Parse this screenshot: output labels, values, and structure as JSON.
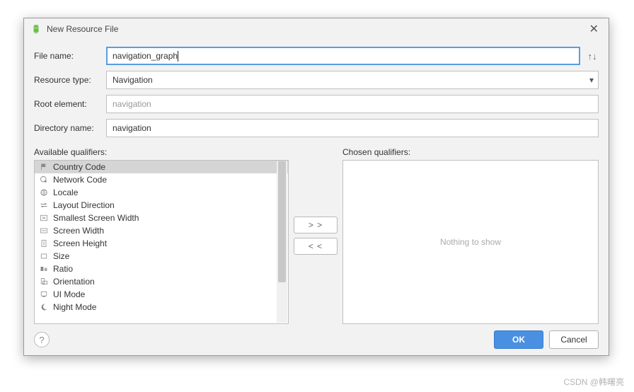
{
  "titlebar": {
    "title": "New Resource File",
    "close_glyph": "✕"
  },
  "form": {
    "file_name": {
      "label": "File name:",
      "value": "navigation_graph",
      "swap_glyph": "↑↓"
    },
    "resource_type": {
      "label": "Resource type:",
      "value": "Navigation"
    },
    "root_element": {
      "label": "Root element:",
      "value": "navigation"
    },
    "directory_name": {
      "label": "Directory name:",
      "value": "navigation"
    }
  },
  "qualifiers": {
    "available_title": "Available qualifiers:",
    "chosen_title": "Chosen qualifiers:",
    "available": [
      {
        "label": "Country Code",
        "icon": "flag",
        "selected": true
      },
      {
        "label": "Network Code",
        "icon": "globe-pin"
      },
      {
        "label": "Locale",
        "icon": "globe"
      },
      {
        "label": "Layout Direction",
        "icon": "arrows"
      },
      {
        "label": "Smallest Screen Width",
        "icon": "sw"
      },
      {
        "label": "Screen Width",
        "icon": "w"
      },
      {
        "label": "Screen Height",
        "icon": "h"
      },
      {
        "label": "Size",
        "icon": "rect"
      },
      {
        "label": "Ratio",
        "icon": "ratio"
      },
      {
        "label": "Orientation",
        "icon": "orient"
      },
      {
        "label": "UI Mode",
        "icon": "ui"
      },
      {
        "label": "Night Mode",
        "icon": "moon"
      }
    ],
    "add_label": "> >",
    "remove_label": "< <",
    "chosen_empty": "Nothing to show"
  },
  "footer": {
    "help_glyph": "?",
    "ok_label": "OK",
    "cancel_label": "Cancel"
  },
  "watermark": "CSDN @韩曙亮"
}
